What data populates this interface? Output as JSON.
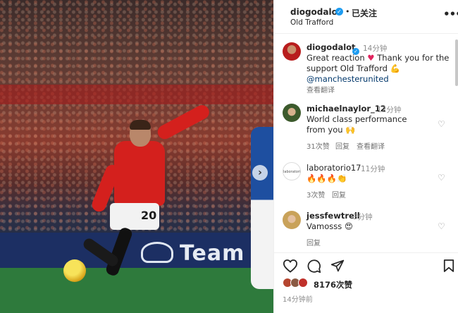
{
  "post": {
    "author": "diogodalot",
    "follow_state": "已关注",
    "location": "Old Trafford",
    "more_icon": "more-horizontal-icon"
  },
  "photo": {
    "board_text": "Team",
    "number": "20"
  },
  "caption": {
    "user": "diogodalot",
    "time": "14分钟",
    "text_1": "Great reaction ",
    "text_2": " Thank you for the support Old Trafford ",
    "mention": "@manchesterunited",
    "translate": "查看翻译"
  },
  "comments": [
    {
      "user": "michaelnaylor_12",
      "time": "12分钟",
      "text": "World class performance from you ",
      "emoji": "🙌",
      "likes": "31次赞",
      "reply": "回复",
      "translate": "查看翻译"
    },
    {
      "user": "laboratorio17",
      "time": "11分钟",
      "text": "",
      "emoji": "🔥🔥🔥👏",
      "likes": "3次赞",
      "reply": "回复",
      "avatar_text": "laboratorio17"
    },
    {
      "user": "jessfewtrell",
      "time": "3分钟",
      "text": "Vamosss ",
      "emoji": "😍",
      "reply": "回复"
    }
  ],
  "actions": {
    "like_icon": "heart-icon",
    "comment_icon": "comment-icon",
    "share_icon": "send-icon",
    "save_icon": "bookmark-icon"
  },
  "likes_count": "8176次赞",
  "post_time": "14分钟前",
  "colors": {
    "verified": "#1d9bf0",
    "link": "#00376b",
    "muted": "#8e8e8e"
  }
}
